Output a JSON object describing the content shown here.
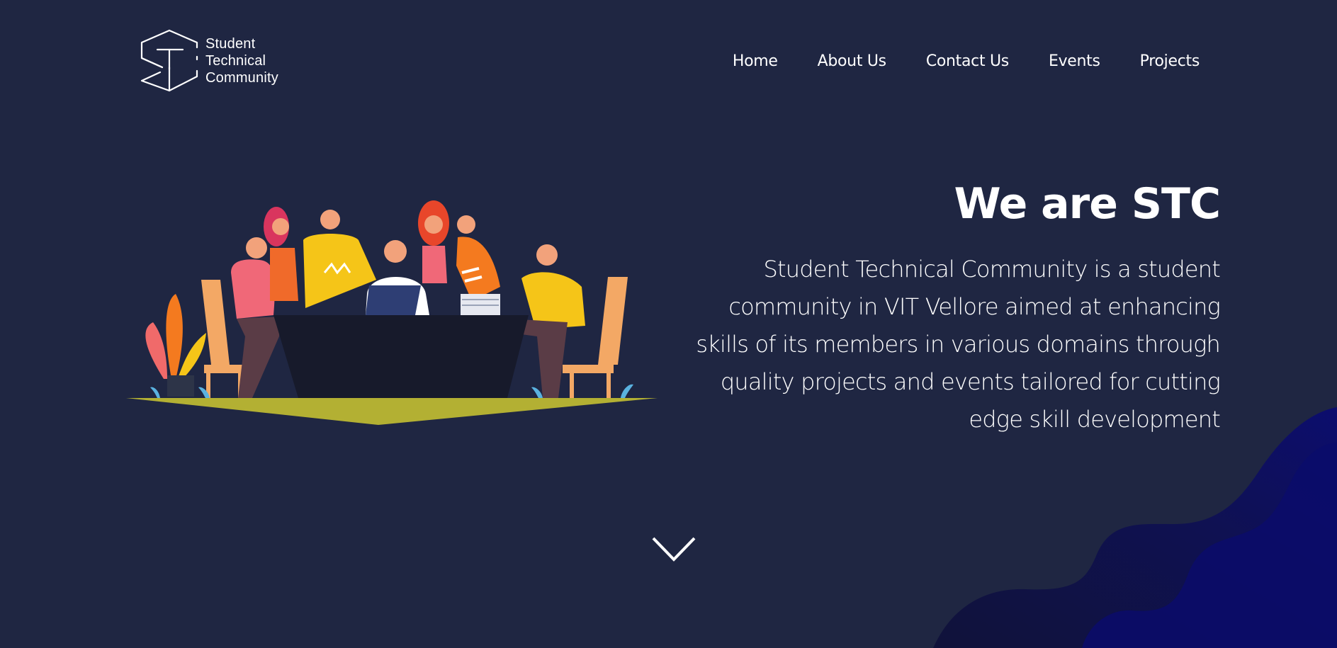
{
  "header": {
    "logo": {
      "line1": "Student",
      "line2": "Technical",
      "line3": "Community"
    },
    "nav": [
      {
        "label": "Home"
      },
      {
        "label": "About Us"
      },
      {
        "label": "Contact Us"
      },
      {
        "label": "Events"
      },
      {
        "label": "Projects"
      }
    ]
  },
  "hero": {
    "title": "We are STC",
    "description": "Student Technical Community is a student community in VIT Vellore aimed at enhancing skills of its members in various domains through quality projects and events tailored for cutting edge skill development"
  },
  "icons": {
    "scroll": "chevron-down-icon",
    "logo": "stc-logo-icon"
  },
  "colors": {
    "background": "#1f2642",
    "wave_dark": "#0f1152",
    "wave_deep": "#0b0c6b",
    "ground": "#b3b033"
  }
}
